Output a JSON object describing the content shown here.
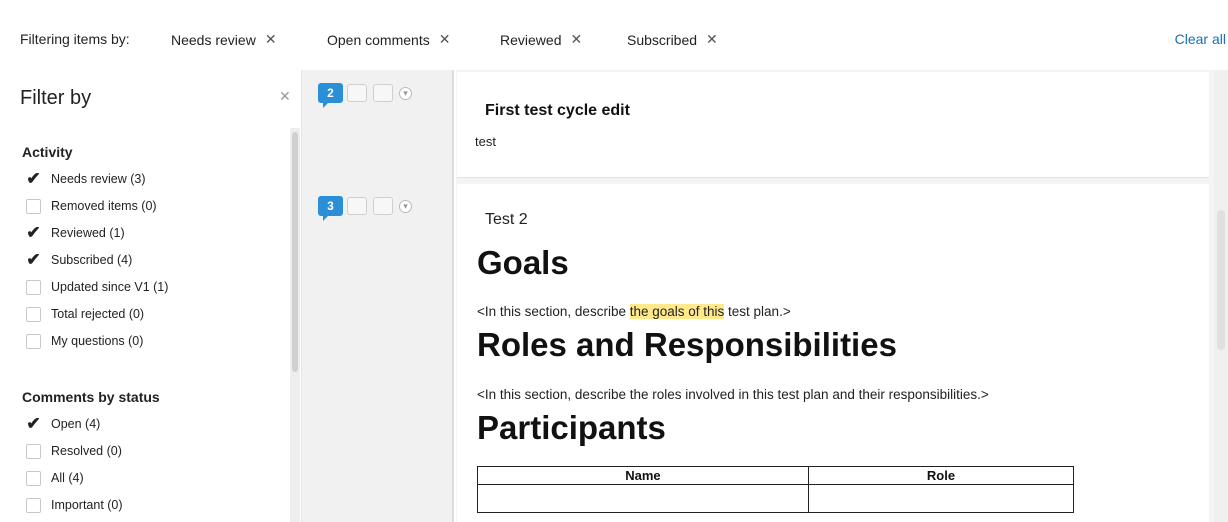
{
  "filter_bar": {
    "label": "Filtering items by:",
    "chips": [
      {
        "label": "Needs review",
        "remove_glyph": "✕"
      },
      {
        "label": "Open comments",
        "remove_glyph": "✕"
      },
      {
        "label": "Reviewed",
        "remove_glyph": "✕"
      },
      {
        "label": "Subscribed",
        "remove_glyph": "✕"
      }
    ],
    "clear_all": "Clear all"
  },
  "filter_panel": {
    "title": "Filter by",
    "close_glyph": "✕",
    "sections": [
      {
        "title": "Activity",
        "items": [
          {
            "label": "Needs review (3)",
            "checked": true,
            "enabled": true
          },
          {
            "label": "Removed items (0)",
            "checked": false,
            "enabled": false
          },
          {
            "label": "Reviewed (1)",
            "checked": true,
            "enabled": true
          },
          {
            "label": "Subscribed (4)",
            "checked": true,
            "enabled": true
          },
          {
            "label": "Updated since V1 (1)",
            "checked": false,
            "enabled": true
          },
          {
            "label": "Total rejected (0)",
            "checked": false,
            "enabled": false
          },
          {
            "label": "My questions (0)",
            "checked": false,
            "enabled": false
          }
        ]
      },
      {
        "title": "Comments by status",
        "items": [
          {
            "label": "Open (4)",
            "checked": true,
            "enabled": true
          },
          {
            "label": "Resolved (0)",
            "checked": false,
            "enabled": false
          },
          {
            "label": "All (4)",
            "checked": false,
            "enabled": true
          },
          {
            "label": "Important (0)",
            "checked": false,
            "enabled": false
          }
        ]
      }
    ]
  },
  "gutter": {
    "rows": [
      {
        "count": "2",
        "menu_glyph": "▾"
      },
      {
        "count": "3",
        "menu_glyph": "▾"
      }
    ]
  },
  "items": [
    {
      "title": "First test cycle edit",
      "body": "test"
    },
    {
      "subtitle": "Test 2",
      "heading_goals": "Goals",
      "goals_text_before": "<In this section, describe ",
      "goals_text_highlight": "the goals of this",
      "goals_text_after": " test plan.>",
      "heading_roles": "Roles and Responsibilities",
      "roles_text": "<In this section, describe the roles involved in this test plan and their responsibilities.>",
      "heading_participants": "Participants",
      "table": {
        "headers": [
          "Name",
          "Role"
        ]
      }
    }
  ],
  "colors": {
    "accent": "#1a6fb5",
    "badge": "#2a8fd6",
    "highlight": "#ffe98a"
  }
}
